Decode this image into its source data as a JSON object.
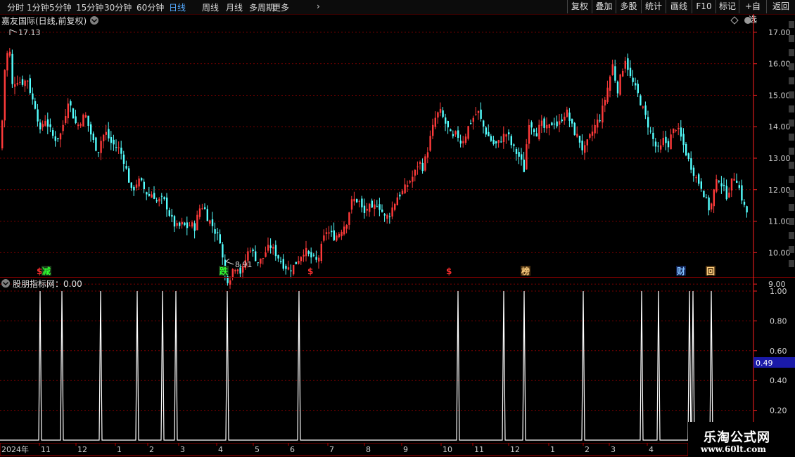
{
  "toolbar": {
    "periods": [
      "分时",
      "1分钟",
      "5分钟",
      "15分钟",
      "30分钟",
      "60分钟",
      "日线",
      "周线",
      "月线",
      "多周期",
      "更多"
    ],
    "active_period": "日线",
    "buttons": [
      "复权",
      "叠加",
      "多股",
      "统计",
      "画线",
      "F10",
      "标记",
      "+自选",
      "返回"
    ]
  },
  "main_chart": {
    "title": "嘉友国际(日线,前复权)",
    "high_label": "17.13",
    "low_label": "8.91",
    "y_ticks": [
      "17.00",
      "16.00",
      "15.00",
      "14.00",
      "13.00",
      "12.00",
      "11.00",
      "10.00",
      "9.00"
    ],
    "markers": [
      {
        "text": "$",
        "color": "#ff3030",
        "bg": ""
      },
      {
        "text": "减",
        "color": "#30ff30",
        "bg": "#1a3a1a"
      },
      {
        "text": "跌",
        "color": "#30ff30",
        "bg": "#1a3a1a"
      },
      {
        "text": "$",
        "color": "#ff3030",
        "bg": ""
      },
      {
        "text": "$",
        "color": "#ff3030",
        "bg": ""
      },
      {
        "text": "榜",
        "color": "#ffd080",
        "bg": "#4a3010"
      },
      {
        "text": "财",
        "color": "#80c0ff",
        "bg": "#102050"
      },
      {
        "text": "回",
        "color": "#ffd080",
        "bg": "#4a3010"
      }
    ]
  },
  "indicator": {
    "title": "股朋指标网：0.00",
    "y_ticks": [
      "1.00",
      "0.80",
      "0.60",
      "0.40",
      "0.20"
    ],
    "current_value": "0.49"
  },
  "time_axis": {
    "labels": [
      "2024年",
      "11",
      "12",
      "1",
      "2",
      "3",
      "4",
      "5",
      "6",
      "7",
      "8",
      "9",
      "10",
      "11",
      "12",
      "1",
      "2",
      "3",
      "4"
    ]
  },
  "watermark": {
    "title": "乐淘公式网",
    "url": "www.60lt.com"
  },
  "colors": {
    "up": "#ff3a3a",
    "down": "#54ffff",
    "grid": "#7a0000",
    "axis": "#ff2020"
  },
  "chart_data": {
    "type": "candlestick",
    "ylim": [
      8.6,
      17.4
    ],
    "close_path": [
      [
        0,
        13.3
      ],
      [
        6,
        16.0
      ],
      [
        12,
        16.6
      ],
      [
        16,
        15.3
      ],
      [
        22,
        15.5
      ],
      [
        30,
        15.4
      ],
      [
        38,
        15.5
      ],
      [
        44,
        14.9
      ],
      [
        50,
        14.6
      ],
      [
        56,
        13.8
      ],
      [
        62,
        14.3
      ],
      [
        68,
        14.0
      ],
      [
        76,
        13.6
      ],
      [
        84,
        13.7
      ],
      [
        90,
        14.2
      ],
      [
        96,
        14.9
      ],
      [
        102,
        14.4
      ],
      [
        108,
        14.0
      ],
      [
        114,
        14.2
      ],
      [
        120,
        14.4
      ],
      [
        126,
        13.9
      ],
      [
        132,
        13.5
      ],
      [
        138,
        13.2
      ],
      [
        144,
        13.7
      ],
      [
        150,
        13.8
      ],
      [
        156,
        13.5
      ],
      [
        162,
        13.4
      ],
      [
        168,
        13.3
      ],
      [
        174,
        13.0
      ],
      [
        180,
        12.5
      ],
      [
        186,
        11.9
      ],
      [
        192,
        12.2
      ],
      [
        198,
        12.3
      ],
      [
        204,
        12.0
      ],
      [
        210,
        11.8
      ],
      [
        216,
        11.9
      ],
      [
        222,
        11.6
      ],
      [
        228,
        11.7
      ],
      [
        234,
        11.6
      ],
      [
        240,
        11.2
      ],
      [
        246,
        10.9
      ],
      [
        252,
        10.8
      ],
      [
        258,
        10.9
      ],
      [
        264,
        10.8
      ],
      [
        270,
        10.9
      ],
      [
        276,
        10.8
      ],
      [
        282,
        11.4
      ],
      [
        288,
        11.5
      ],
      [
        294,
        11.1
      ],
      [
        300,
        10.9
      ],
      [
        306,
        10.6
      ],
      [
        312,
        10.4
      ],
      [
        318,
        9.3
      ],
      [
        324,
        9.1
      ],
      [
        330,
        9.5
      ],
      [
        336,
        9.6
      ],
      [
        342,
        9.3
      ],
      [
        348,
        9.8
      ],
      [
        354,
        10.2
      ],
      [
        360,
        9.9
      ],
      [
        366,
        9.7
      ],
      [
        372,
        9.8
      ],
      [
        378,
        10.1
      ],
      [
        384,
        10.2
      ],
      [
        390,
        10.0
      ],
      [
        396,
        9.8
      ],
      [
        402,
        9.6
      ],
      [
        408,
        9.5
      ],
      [
        414,
        9.5
      ],
      [
        420,
        9.7
      ],
      [
        426,
        9.9
      ],
      [
        432,
        10.1
      ],
      [
        438,
        9.9
      ],
      [
        444,
        9.8
      ],
      [
        450,
        9.7
      ],
      [
        456,
        10.2
      ],
      [
        462,
        10.7
      ],
      [
        468,
        10.6
      ],
      [
        474,
        10.5
      ],
      [
        480,
        10.6
      ],
      [
        486,
        10.8
      ],
      [
        492,
        11.0
      ],
      [
        498,
        11.6
      ],
      [
        504,
        11.7
      ],
      [
        510,
        11.6
      ],
      [
        516,
        11.2
      ],
      [
        522,
        11.5
      ],
      [
        528,
        11.3
      ],
      [
        534,
        11.6
      ],
      [
        540,
        11.4
      ],
      [
        546,
        11.1
      ],
      [
        552,
        11.2
      ],
      [
        558,
        11.5
      ],
      [
        564,
        11.8
      ],
      [
        570,
        11.9
      ],
      [
        576,
        12.1
      ],
      [
        582,
        12.3
      ],
      [
        588,
        12.5
      ],
      [
        594,
        12.9
      ],
      [
        600,
        12.7
      ],
      [
        606,
        13.2
      ],
      [
        612,
        13.8
      ],
      [
        618,
        14.3
      ],
      [
        624,
        14.5
      ],
      [
        630,
        14.2
      ],
      [
        636,
        13.9
      ],
      [
        642,
        13.6
      ],
      [
        648,
        13.8
      ],
      [
        654,
        13.5
      ],
      [
        660,
        13.7
      ],
      [
        666,
        14.1
      ],
      [
        672,
        14.3
      ],
      [
        678,
        14.5
      ],
      [
        684,
        14.1
      ],
      [
        690,
        13.8
      ],
      [
        696,
        13.6
      ],
      [
        702,
        13.4
      ],
      [
        708,
        13.5
      ],
      [
        714,
        13.7
      ],
      [
        720,
        13.8
      ],
      [
        726,
        13.4
      ],
      [
        732,
        13.2
      ],
      [
        738,
        13.0
      ],
      [
        744,
        12.6
      ],
      [
        750,
        14.2
      ],
      [
        756,
        14.0
      ],
      [
        762,
        13.8
      ],
      [
        768,
        14.1
      ],
      [
        774,
        13.9
      ],
      [
        780,
        14.0
      ],
      [
        786,
        14.2
      ],
      [
        792,
        14.0
      ],
      [
        798,
        14.3
      ],
      [
        804,
        14.5
      ],
      [
        810,
        14.1
      ],
      [
        816,
        13.8
      ],
      [
        822,
        13.6
      ],
      [
        828,
        13.2
      ],
      [
        834,
        13.5
      ],
      [
        840,
        13.8
      ],
      [
        846,
        14.1
      ],
      [
        852,
        14.3
      ],
      [
        858,
        14.8
      ],
      [
        864,
        15.4
      ],
      [
        870,
        16.0
      ],
      [
        876,
        15.1
      ],
      [
        882,
        15.7
      ],
      [
        888,
        16.2
      ],
      [
        894,
        15.6
      ],
      [
        900,
        15.3
      ],
      [
        906,
        15.0
      ],
      [
        912,
        14.6
      ],
      [
        918,
        14.2
      ],
      [
        924,
        13.8
      ],
      [
        930,
        13.4
      ],
      [
        936,
        13.2
      ],
      [
        942,
        13.6
      ],
      [
        948,
        13.4
      ],
      [
        954,
        13.8
      ],
      [
        960,
        14.0
      ],
      [
        966,
        13.7
      ],
      [
        972,
        13.3
      ],
      [
        978,
        12.9
      ],
      [
        984,
        12.6
      ],
      [
        990,
        12.3
      ],
      [
        996,
        12.1
      ],
      [
        1002,
        11.7
      ],
      [
        1008,
        11.3
      ],
      [
        1014,
        12.0
      ],
      [
        1020,
        12.4
      ],
      [
        1026,
        12.1
      ],
      [
        1032,
        11.8
      ],
      [
        1038,
        12.2
      ],
      [
        1044,
        12.5
      ],
      [
        1050,
        12.0
      ],
      [
        1056,
        11.5
      ],
      [
        1062,
        11.2
      ]
    ],
    "indicator_spikes_x": [
      57,
      88,
      143,
      195,
      231,
      250,
      323,
      425,
      651,
      716,
      745,
      829,
      912,
      936,
      980,
      985,
      1011
    ]
  }
}
